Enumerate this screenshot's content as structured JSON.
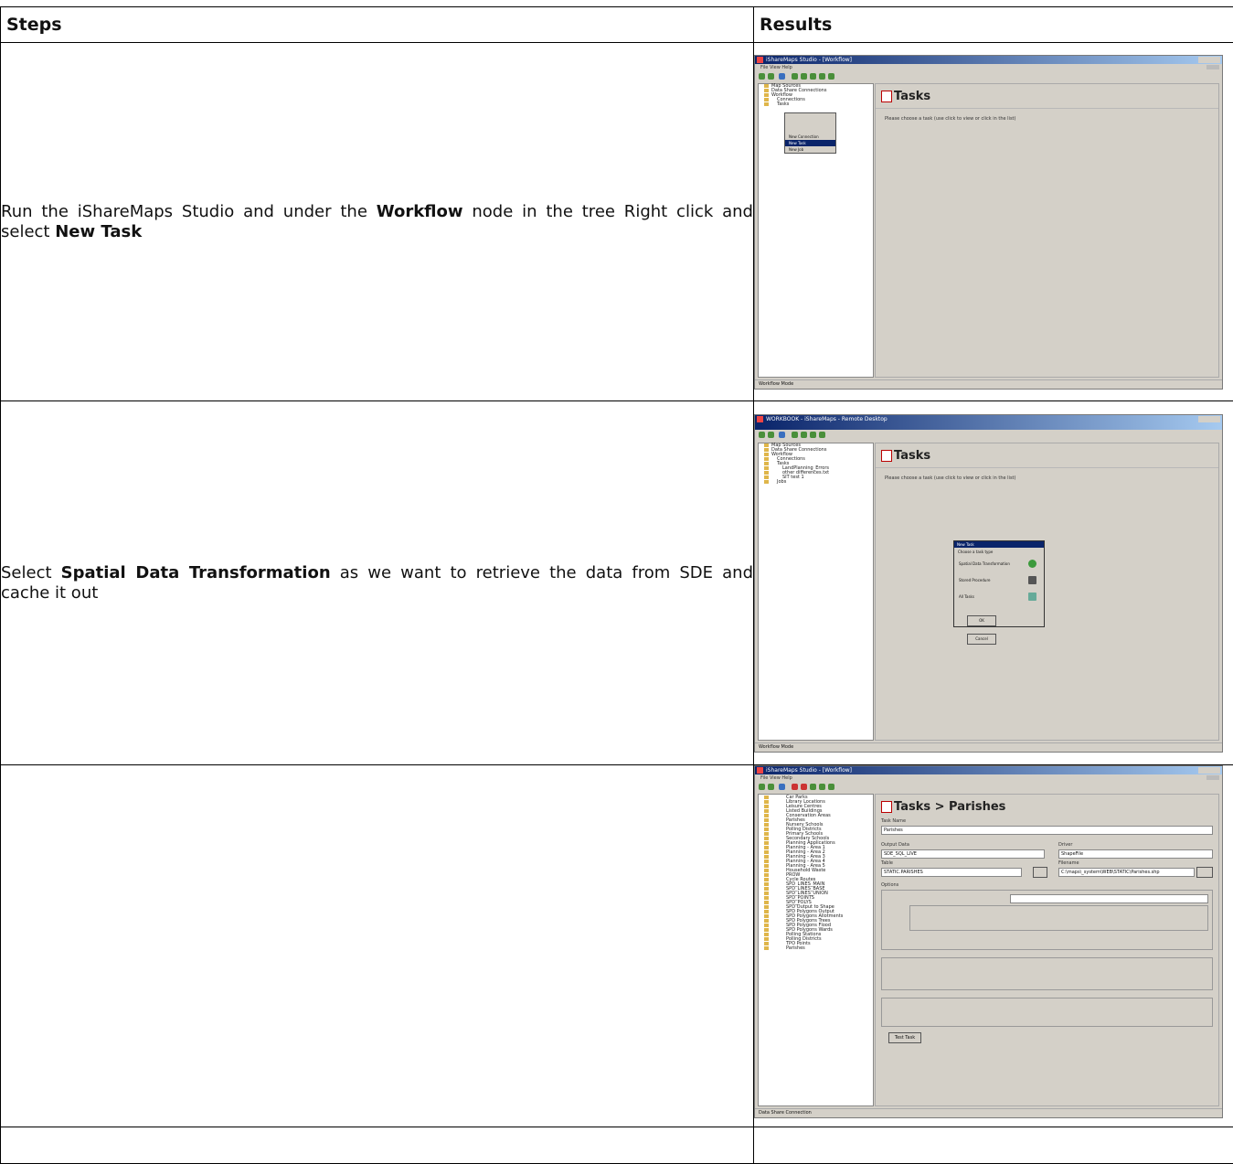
{
  "table": {
    "header_steps": "Steps",
    "header_results": "Results"
  },
  "rows": [
    {
      "text_parts": [
        "Run the iShareMaps Studio and under the ",
        "Workflow",
        " node in the tree Right click and select ",
        "New Task"
      ]
    },
    {
      "text_parts": [
        "Select ",
        "Spatial Data Transformation",
        " as we want to retrieve the data from SDE and cache it out"
      ]
    },
    {
      "text_parts": []
    }
  ],
  "shots": {
    "shot1": {
      "title": "iShareMaps Studio - [Workflow]",
      "menu": "File  View  Help",
      "panel_title": "Tasks",
      "hint": "Please choose a task (use click to view or click in the list)",
      "tree": [
        "Map Sources",
        "Data Share Connections",
        "Workflow",
        "Connections",
        "Tasks"
      ],
      "context_menu": [
        "New Connection",
        "New Task",
        "New Job"
      ],
      "status": "Workflow Mode"
    },
    "shot2": {
      "title": "WORKBOOK - iShareMaps - Remote Desktop",
      "panel_title": "Tasks",
      "hint": "Please choose a task (use click to view or click in the list)",
      "tree": [
        "Map Sources",
        "Data Share Connections",
        "Workflow",
        "Connections",
        "Tasks",
        "LandPlanning_Errors",
        "other differences.txt",
        "SIT test 1",
        "Jobs"
      ],
      "dialog_title": "New Task",
      "dialog_prompt": "Choose a task type",
      "dialog_options": [
        "Spatial Data Transformation",
        "Stored Procedure",
        "All Tasks"
      ],
      "ok": "OK",
      "cancel": "Cancel",
      "status": "Workflow Mode"
    },
    "shot3": {
      "title": "iShareMaps Studio - [Workflow]",
      "panel_title": "Tasks > Parishes",
      "task_name_label": "Task Name",
      "task_name": "Parishes",
      "tree": [
        "Car Parks",
        "Library Locations",
        "Leisure Centres",
        "Listed Buildings",
        "Conservation Areas",
        "Parishes",
        "Nursery Schools",
        "Polling Districts",
        "Primary Schools",
        "Secondary Schools",
        "Planning Applications",
        "Planning - Area 1",
        "Planning - Area 2",
        "Planning - Area 3",
        "Planning - Area 4",
        "Planning - Area 5",
        "Household Waste",
        "PROW",
        "Cycle Routes",
        "SPD_LINES_MAIN",
        "SPD_LINES_BASE",
        "SPD_LINES_UNION",
        "SPD_POINTS",
        "SPD_POLYS",
        "SPD Output to Shape",
        "SPD Polygons Output",
        "SPD Polygons Allotments",
        "SPD Polygons Trees",
        "SPD Polygons Flood",
        "SPD Polygons Wards",
        "Polling Stations",
        "Polling Districts",
        "TPO Points",
        "Parishes"
      ],
      "status": "Data Share Connection",
      "source_label": "Output Data",
      "source_value": "SDE_SQL_LIVE",
      "driver_label": "Driver",
      "driver_value": "ShapeFile",
      "table_label": "Table",
      "table_value": "STATIC.PARISHES",
      "filename_label": "Filename",
      "filename_value": "C:\\maps\\_system\\WEB\\STATIC\\Parishes.shp",
      "options_label": "Options",
      "finish_button": "Test Task"
    }
  }
}
